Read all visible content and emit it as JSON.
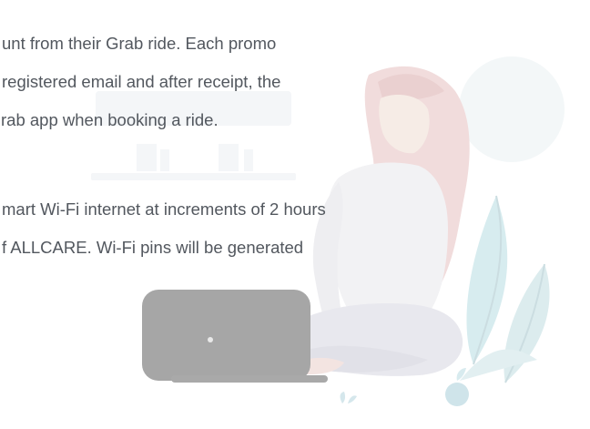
{
  "content": {
    "grab_lines": [
      "unt from their Grab ride. Each promo",
      "registered email and after receipt, the",
      "rab app when booking a ride."
    ],
    "wifi_lines": [
      "mart Wi-Fi internet at increments of 2 hours",
      "f ALLCARE. Wi-Fi pins will be generated"
    ]
  }
}
